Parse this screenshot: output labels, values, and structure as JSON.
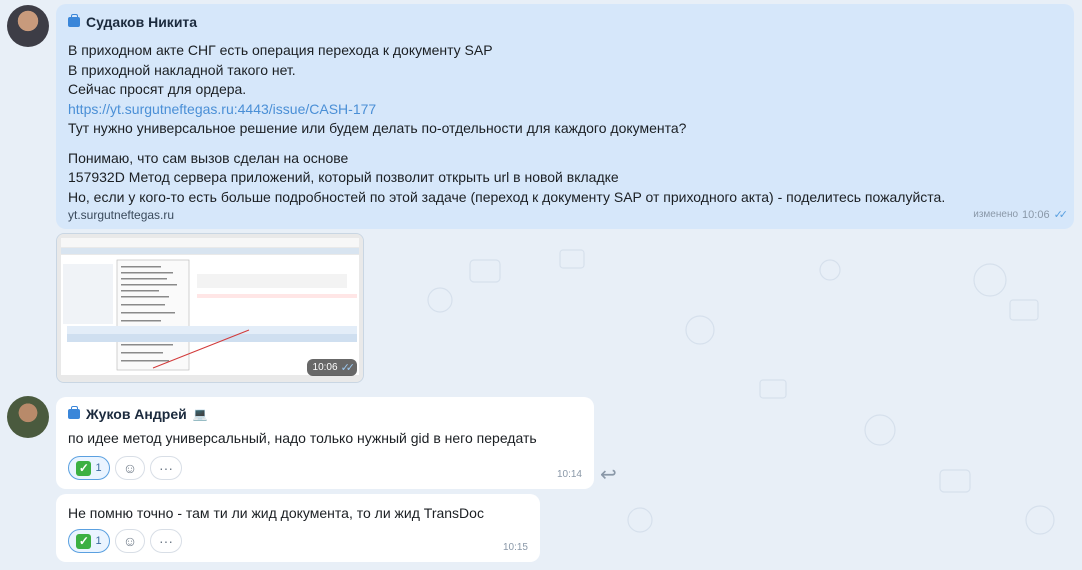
{
  "colors": {
    "accent": "#4a8fd6",
    "own_bubble": "#d6e7fa",
    "bubble": "#ffffff",
    "background": "#e8eff7"
  },
  "messages": [
    {
      "author": "Судаков Никита",
      "lines": [
        "В приходном акте СНГ есть операция перехода к документу SAP",
        "В приходной накладной такого нет.",
        "Сейчас просят для ордера."
      ],
      "link": "https://yt.surgutneftegas.ru:4443/issue/CASH-177",
      "line_after_link": "Тут нужно универсальное решение или будем делать по-отдельности для каждого документа?",
      "paragraph2": [
        "Понимаю, что сам вызов сделан на основе",
        "157932D Метод сервера приложений, который позволит открыть url в новой вкладке",
        "Но, если у кого-то есть больше подробностей по этой задаче (переход к документу SAP от приходного акта) - поделитесь пожалуйста."
      ],
      "domain": "yt.surgutneftegas.ru",
      "edited_label": "изменено",
      "time": "10:06"
    },
    {
      "image_time": "10:06"
    },
    {
      "author": "Жуков Андрей",
      "author_emoji": "💻",
      "text": "по идее метод универсальный, надо только нужный gid в него передать",
      "reaction_emoji": "✓",
      "reaction_count": "1",
      "time": "10:14"
    },
    {
      "text": "Не помню точно - там ти ли жид документа, то ли жид TransDoc",
      "reaction_emoji": "✓",
      "reaction_count": "1",
      "time": "10:15"
    }
  ],
  "icons": {
    "react": "smile-icon",
    "more": "more-icon",
    "reply": "reply-arrow-icon"
  },
  "glyphs": {
    "smile": "☺",
    "more": "···",
    "reply": "↩",
    "checks": "✓✓"
  }
}
